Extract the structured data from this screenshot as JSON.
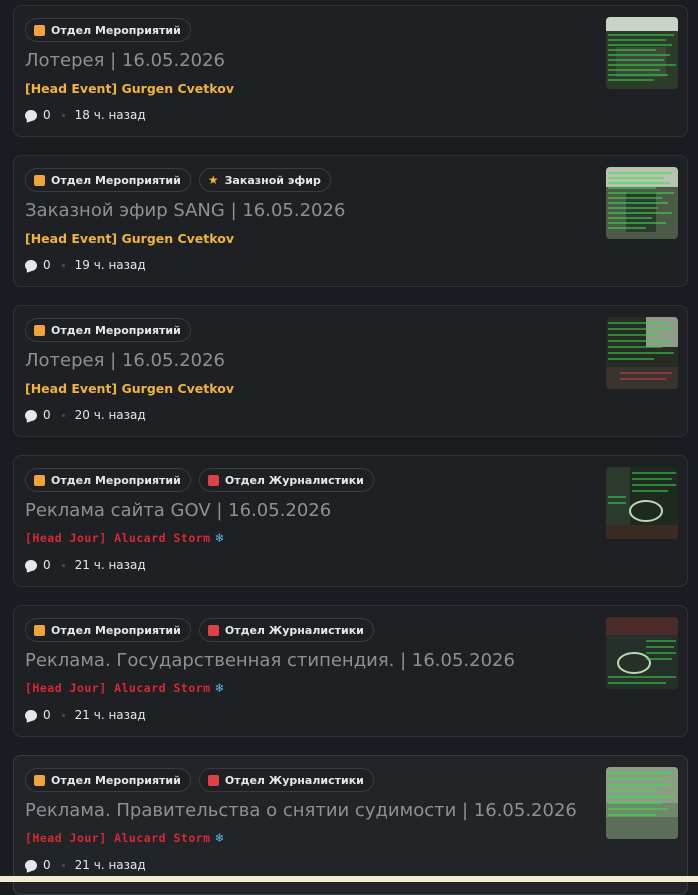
{
  "posts": [
    {
      "tags": [
        {
          "label": "Отдел Мероприятий",
          "icon": "orange-square"
        }
      ],
      "title": "Лотерея | 16.05.2026",
      "author": "[Head Event] Gurgen Cvetkov",
      "comments": "0",
      "time": "18 ч. назад"
    },
    {
      "tags": [
        {
          "label": "Отдел Мероприятий",
          "icon": "orange-square"
        },
        {
          "label": "Заказной эфир",
          "icon": "star"
        }
      ],
      "title": "Заказной эфир SANG | 16.05.2026",
      "author": "[Head Event] Gurgen Cvetkov",
      "comments": "0",
      "time": "19 ч. назад"
    },
    {
      "tags": [
        {
          "label": "Отдел Мероприятий",
          "icon": "orange-square"
        }
      ],
      "title": "Лотерея | 16.05.2026",
      "author": "[Head Event] Gurgen Cvetkov",
      "comments": "0",
      "time": "20 ч. назад"
    },
    {
      "tags": [
        {
          "label": "Отдел Мероприятий",
          "icon": "orange-square"
        },
        {
          "label": "Отдел Журналистики",
          "icon": "red-square"
        }
      ],
      "title": "Реклама сайта GOV | 16.05.2026",
      "author": "[Head Jour] Alucard Storm",
      "comments": "0",
      "time": "21 ч. назад"
    },
    {
      "tags": [
        {
          "label": "Отдел Мероприятий",
          "icon": "orange-square"
        },
        {
          "label": "Отдел Журналистики",
          "icon": "red-square"
        }
      ],
      "title": "Реклама. Государственная стипендия. | 16.05.2026",
      "author": "[Head Jour] Alucard Storm",
      "comments": "0",
      "time": "21 ч. назад"
    },
    {
      "tags": [
        {
          "label": "Отдел Мероприятий",
          "icon": "orange-square"
        },
        {
          "label": "Отдел Журналистики",
          "icon": "red-square"
        }
      ],
      "title": "Реклама. Правительства о снятии судимости | 16.05.2026",
      "author": "[Head Jour] Alucard Storm",
      "comments": "0",
      "time": "21 ч. назад"
    }
  ],
  "colors": {
    "background": "#1b1c21",
    "card": "#1f2024",
    "title": "#8e9097",
    "author_event": "#f0b43a",
    "author_jour": "#d42a35",
    "tag_orange": "#f0a33a",
    "tag_red": "#e0404a"
  },
  "icons": {
    "comments": "speech-bubble-icon",
    "separator": "dot",
    "jour_badge": "snowflake-icon"
  }
}
